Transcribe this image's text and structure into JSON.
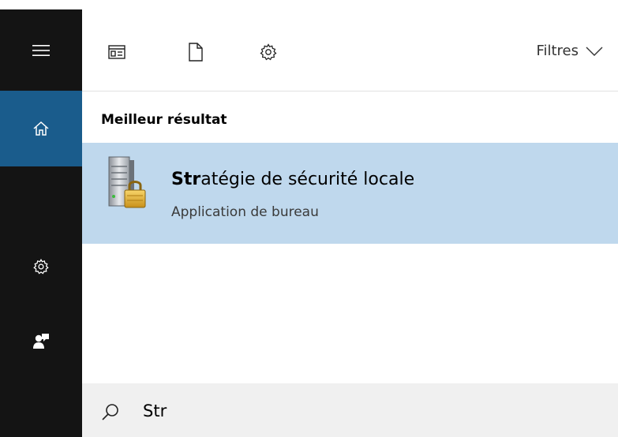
{
  "rail": {
    "icons": [
      "hamburger-menu-icon",
      "home-icon",
      "gear-icon",
      "feedback-icon"
    ],
    "active": "home",
    "colors": {
      "background": "#141414",
      "active": "#1a5c8c"
    }
  },
  "toolbar": {
    "icons": [
      "apps-icon",
      "document-icon",
      "gear-icon"
    ],
    "filters_label": "Filtres"
  },
  "section": {
    "best_match_header": "Meilleur résultat"
  },
  "best_result": {
    "title_match": "Str",
    "title_rest": "atégie de sécurité locale",
    "subtitle": "Application de bureau",
    "icon": "server-lock-icon",
    "highlight_color": "#bfd8ed"
  },
  "search": {
    "value": "Str",
    "icon": "search-icon"
  }
}
